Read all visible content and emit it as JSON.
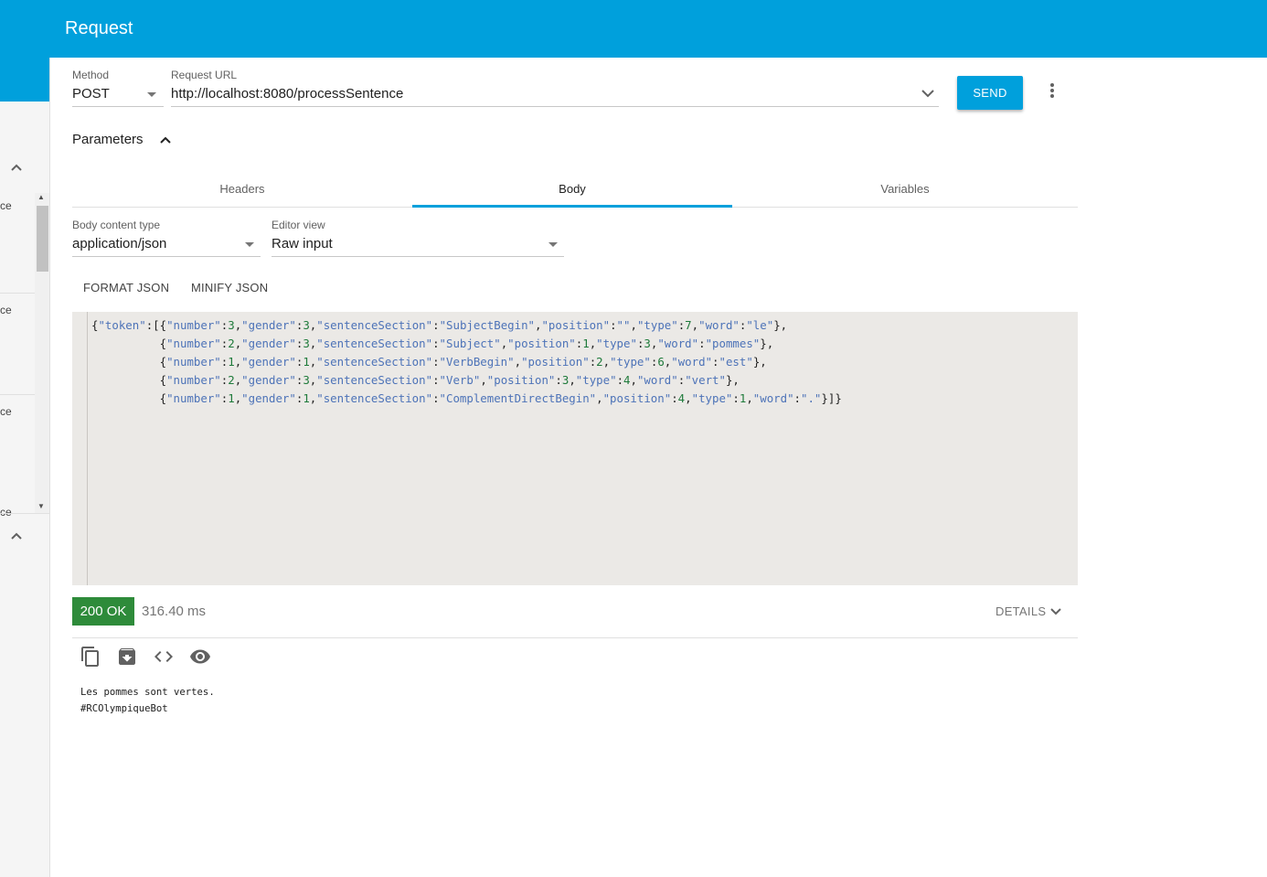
{
  "app": {
    "title": "Request"
  },
  "sidebar": {
    "fragments": [
      "ce",
      "ce",
      "ce",
      "ce"
    ]
  },
  "request": {
    "method_label": "Method",
    "method_value": "POST",
    "url_label": "Request URL",
    "url_value": "http://localhost:8080/processSentence",
    "send_label": "SEND"
  },
  "parameters": {
    "label": "Parameters"
  },
  "tabs": [
    {
      "label": "Headers"
    },
    {
      "label": "Body"
    },
    {
      "label": "Variables"
    }
  ],
  "body": {
    "content_type_label": "Body content type",
    "content_type_value": "application/json",
    "editor_view_label": "Editor view",
    "editor_view_value": "Raw input",
    "format_json_label": "FORMAT JSON",
    "minify_json_label": "MINIFY JSON",
    "code_lines": [
      "{\"token\":[{\"number\":3,\"gender\":3,\"sentenceSection\":\"SubjectBegin\",\"position\":\"\",\"type\":7,\"word\":\"le\"},",
      "          {\"number\":2,\"gender\":3,\"sentenceSection\":\"Subject\",\"position\":1,\"type\":3,\"word\":\"pommes\"},",
      "          {\"number\":1,\"gender\":1,\"sentenceSection\":\"VerbBegin\",\"position\":2,\"type\":6,\"word\":\"est\"},",
      "          {\"number\":2,\"gender\":3,\"sentenceSection\":\"Verb\",\"position\":3,\"type\":4,\"word\":\"vert\"},",
      "          {\"number\":1,\"gender\":1,\"sentenceSection\":\"ComplementDirectBegin\",\"position\":4,\"type\":1,\"word\":\".\"}]}"
    ]
  },
  "response": {
    "status": "200 OK",
    "time": "316.40 ms",
    "details_label": "DETAILS",
    "text_lines": [
      "Les pommes sont vertes.",
      "#RCOlympiqueBot"
    ]
  },
  "icons": [
    "copy-icon",
    "save-icon",
    "code-icon",
    "eye-icon",
    "chevron-up-icon",
    "chevron-down-icon",
    "more-vert-icon"
  ],
  "colors": {
    "accent": "#00a0dc",
    "status_ok": "#2e8b3a"
  }
}
